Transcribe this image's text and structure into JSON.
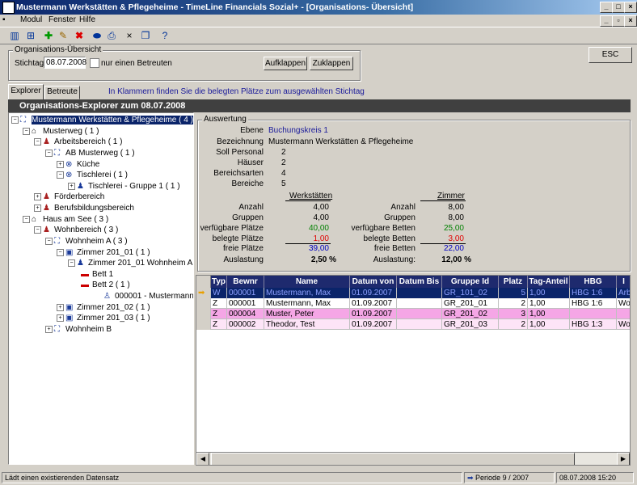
{
  "window": {
    "title": "Mustermann Werkstätten & Pflegeheime - TimeLine Financials Sozial+ - [Organisations- Übersicht]"
  },
  "menu": [
    "Modul",
    "Fenster",
    "Hilfe"
  ],
  "org_overview": {
    "group_title": "Organisations-Übersicht",
    "stichtag_label": "Stichtag",
    "stichtag_value": "08.07.2008",
    "only_occupied_label": "nur einen Betreuten",
    "expand_label": "Aufklappen",
    "collapse_label": "Zuklappen",
    "esc_label": "ESC"
  },
  "tabs": [
    "Explorer",
    "Betreute"
  ],
  "hint": "In Klammern finden Sie die belegten Plätze zum ausgewählten Stichtag",
  "explorer_header": "Organisations-Explorer zum 08.07.2008",
  "tree": [
    {
      "label": "Mustermann Werkstätten & Pflegeheime ( 4 )"
    },
    {
      "label": "Musterweg  ( 1 )"
    },
    {
      "label": "Arbeitsbereich ( 1 )"
    },
    {
      "label": "AB Musterweg ( 1 )"
    },
    {
      "label": "Küche"
    },
    {
      "label": "Tischlerei ( 1 )"
    },
    {
      "label": "Tischlerei - Gruppe 1 ( 1 )"
    },
    {
      "label": "Förderbereich"
    },
    {
      "label": "Berufsbildungsbereich"
    },
    {
      "label": "Haus am See ( 3 )"
    },
    {
      "label": "Wohnbereich ( 3 )"
    },
    {
      "label": "Wohnheim A ( 3 )"
    },
    {
      "label": "Zimmer 201_01 ( 1 )"
    },
    {
      "label": "Zimmer 201_01 Wohnheim A"
    },
    {
      "label": "Bett 1"
    },
    {
      "label": "Bett 2 ( 1 )"
    },
    {
      "label": "000001 - Mustermann"
    },
    {
      "label": "Zimmer 201_02 ( 1 )"
    },
    {
      "label": "Zimmer 201_03 ( 1 )"
    },
    {
      "label": "Wohnheim B"
    }
  ],
  "auswertung": {
    "title": "Auswertung",
    "fields": [
      {
        "label": "Ebene",
        "value": "Buchungskreis 1"
      },
      {
        "label": "Bezeichnung",
        "value": "Mustermann Werkstätten & Pflegeheime"
      },
      {
        "label": "Soll Personal",
        "value": "2"
      },
      {
        "label": "Häuser",
        "value": "2"
      },
      {
        "label": "Bereichsarten",
        "value": "4"
      },
      {
        "label": "Bereiche",
        "value": "5"
      }
    ],
    "left_header": "Werkstätten",
    "right_header": "Zimmer",
    "left_rows": [
      {
        "label": "Anzahl",
        "value": "4,00"
      },
      {
        "label": "Gruppen",
        "value": "4,00"
      },
      {
        "label": "verfügbare Plätze",
        "value": "40,00"
      },
      {
        "label": "belegte Plätze",
        "value": "1,00"
      },
      {
        "label": "freie Plätze",
        "value": "39,00"
      },
      {
        "label": "Auslastung",
        "value": "2,50 %"
      }
    ],
    "right_rows": [
      {
        "label": "Anzahl",
        "value": "8,00"
      },
      {
        "label": "Gruppen",
        "value": "8,00"
      },
      {
        "label": "verfügbare Betten",
        "value": "25,00"
      },
      {
        "label": "belegte Betten",
        "value": "3,00"
      },
      {
        "label": "freie Betten",
        "value": "22,00"
      },
      {
        "label": "Auslastung:",
        "value": "12,00 %"
      }
    ],
    "colors": {
      "green": "#008000",
      "red": "#e00000",
      "blue": "#0000c0"
    }
  },
  "grid": {
    "columns": [
      "Typ",
      "Bewnr",
      "Name",
      "Datum von",
      "Datum Bis",
      "Gruppe Id",
      "Platz Nr",
      "Tag-Anteil",
      "HBG",
      "I"
    ],
    "rows": [
      [
        "W",
        "000001",
        "Mustermann, Max",
        "01.09.2007",
        "",
        "GR_101_02",
        "5",
        "1,00",
        "HBG 1:6",
        "Arbe"
      ],
      [
        "Z",
        "000001",
        "Mustermann, Max",
        "01.09.2007",
        "",
        "GR_201_01",
        "2",
        "1,00",
        "HBG 1:6",
        "Woh"
      ],
      [
        "Z",
        "000004",
        "Muster, Peter",
        "01.09.2007",
        "",
        "GR_201_02",
        "3",
        "1,00",
        "",
        ""
      ],
      [
        "Z",
        "000002",
        "Theodor, Test",
        "01.09.2007",
        "",
        "GR_201_03",
        "2",
        "1,00",
        "HBG 1:3",
        "Woh"
      ]
    ]
  },
  "status": {
    "message": "Lädt einen existierenden Datensatz",
    "period": "Periode  9  / 2007",
    "datetime": "08.07.2008 15:20"
  }
}
